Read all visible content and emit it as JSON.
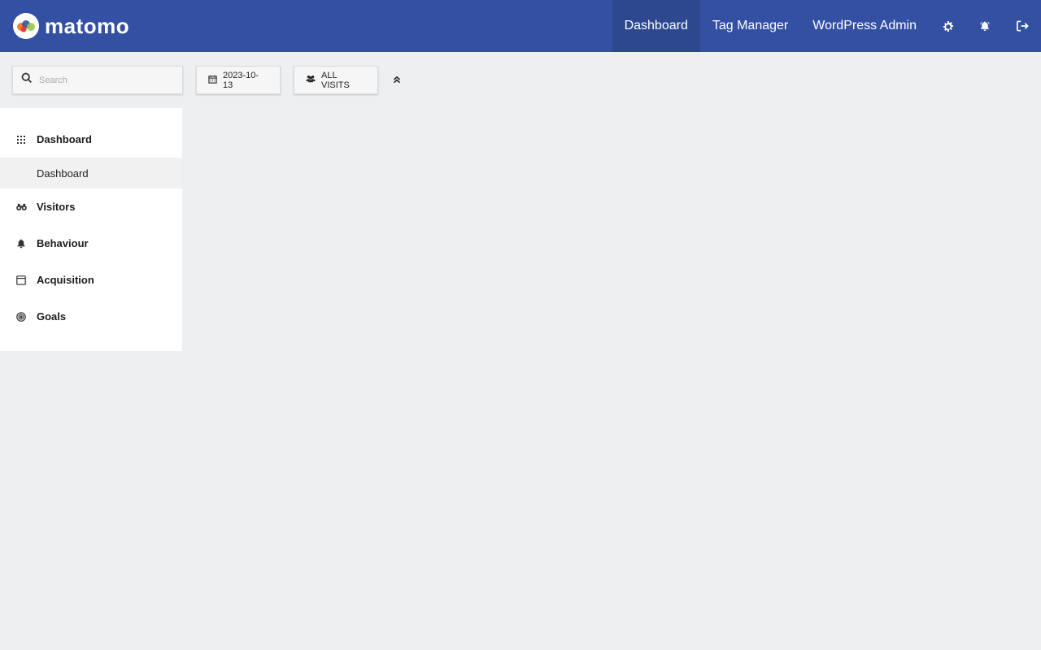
{
  "brand": {
    "name": "matomo"
  },
  "topnav": {
    "items": [
      {
        "label": "Dashboard",
        "active": true
      },
      {
        "label": "Tag Manager"
      },
      {
        "label": "WordPress Admin"
      }
    ],
    "icons": [
      "gear-icon",
      "bell-icon",
      "sign-out-icon"
    ]
  },
  "search": {
    "placeholder": "Search",
    "value": ""
  },
  "filters": {
    "date": "2023-10-13",
    "segment": "ALL VISITS"
  },
  "sidebar": {
    "categories": [
      {
        "label": "Dashboard",
        "icon": "grid-icon",
        "children": [
          "Dashboard"
        ]
      },
      {
        "label": "Visitors",
        "icon": "binoculars-icon"
      },
      {
        "label": "Behaviour",
        "icon": "bell-icon"
      },
      {
        "label": "Acquisition",
        "icon": "browser-window-icon"
      },
      {
        "label": "Goals",
        "icon": "target-icon"
      }
    ]
  },
  "colors": {
    "topbar": "#3450a3",
    "topbar_active": "#2e4890",
    "background": "#eeeff1"
  }
}
